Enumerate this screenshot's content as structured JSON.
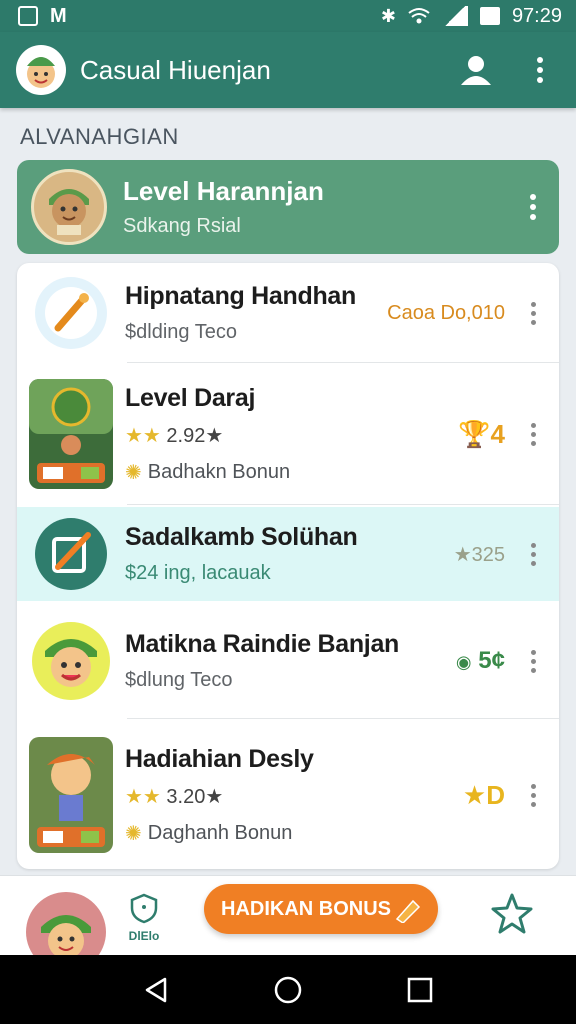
{
  "status_bar": {
    "time": "97:29"
  },
  "app_bar": {
    "title": "Casual Hiuenjan"
  },
  "section": {
    "title": "ALVANAHGIAN"
  },
  "featured": {
    "title": "Level Harannjan",
    "subtitle": "Sdkang Rsial"
  },
  "list": [
    {
      "title": "Hipnatang Handhan",
      "subtitle": "$dlding Teco",
      "badge": "Caoa Do,010",
      "badge_color": "#d88b1f"
    },
    {
      "title": "Level Daraj",
      "rating_stars": "★★",
      "rating_value": "2.92★",
      "bonus": "Badhakn Bonun",
      "badge": "4",
      "badge_color": "#e8a11f"
    },
    {
      "title": "Sadalkamb Solühan",
      "subtitle": "$24 ing, lacauak",
      "subtitle_color": "#3a8a74",
      "badge": "★325",
      "badge_color": "#9aa08a"
    },
    {
      "title": "Matikna Raindie Banjan",
      "subtitle": "$dlung Teco",
      "badge": "5¢",
      "badge_color": "#3a8a4a"
    },
    {
      "title": "Hadiahian Desly",
      "rating_stars": "★★",
      "rating_value": "3.20★",
      "bonus": "Daghanh Bonun",
      "badge": "D",
      "badge_color": "#e8b51f"
    }
  ],
  "bottom_nav": {
    "deals_label": "DlElo",
    "bonus_button": "HADIKAN BONUS"
  },
  "colors": {
    "primary": "#2f7d6d",
    "featured": "#5a9e7c",
    "accent": "#f07f24",
    "highlight": "#dcf7f6"
  }
}
